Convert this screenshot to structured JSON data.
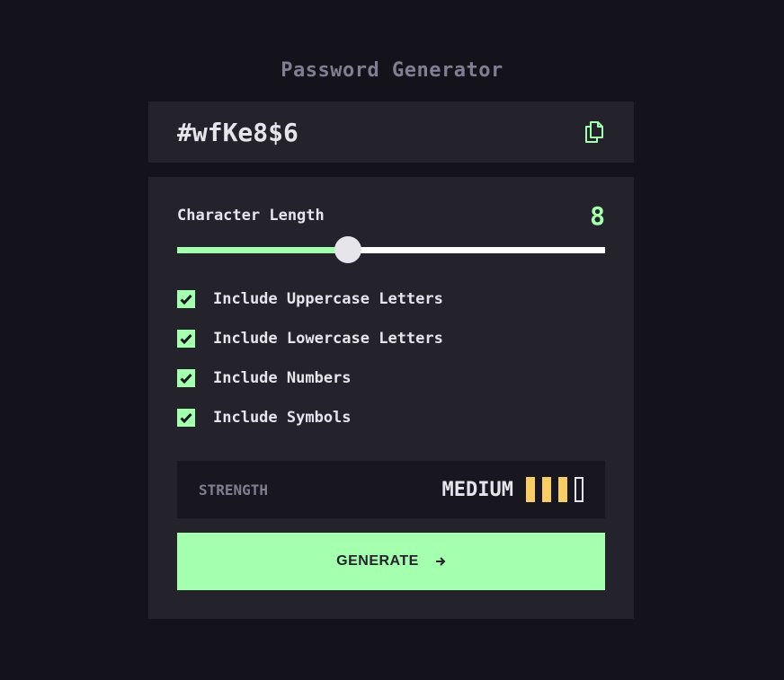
{
  "app": {
    "title": "Password Generator"
  },
  "password": {
    "value": "#wfKe8$6"
  },
  "length": {
    "label": "Character Length",
    "value": "8",
    "slider_fraction": 0.4
  },
  "options": [
    {
      "label": "Include Uppercase Letters",
      "checked": true
    },
    {
      "label": "Include Lowercase Letters",
      "checked": true
    },
    {
      "label": "Include Numbers",
      "checked": true
    },
    {
      "label": "Include Symbols",
      "checked": true
    }
  ],
  "strength": {
    "label": "STRENGTH",
    "value": "MEDIUM",
    "level": 3,
    "max_level": 4
  },
  "generate": {
    "label": "GENERATE"
  },
  "icons": {
    "copy": "copy-icon",
    "check": "check-icon",
    "arrow": "arrow-right-icon"
  },
  "colors": {
    "background": "#14131b",
    "panel": "#24232c",
    "accent": "#a4ffaf",
    "strength_medium": "#f8cd65",
    "muted": "#817d92",
    "text": "#e6e5ea"
  }
}
